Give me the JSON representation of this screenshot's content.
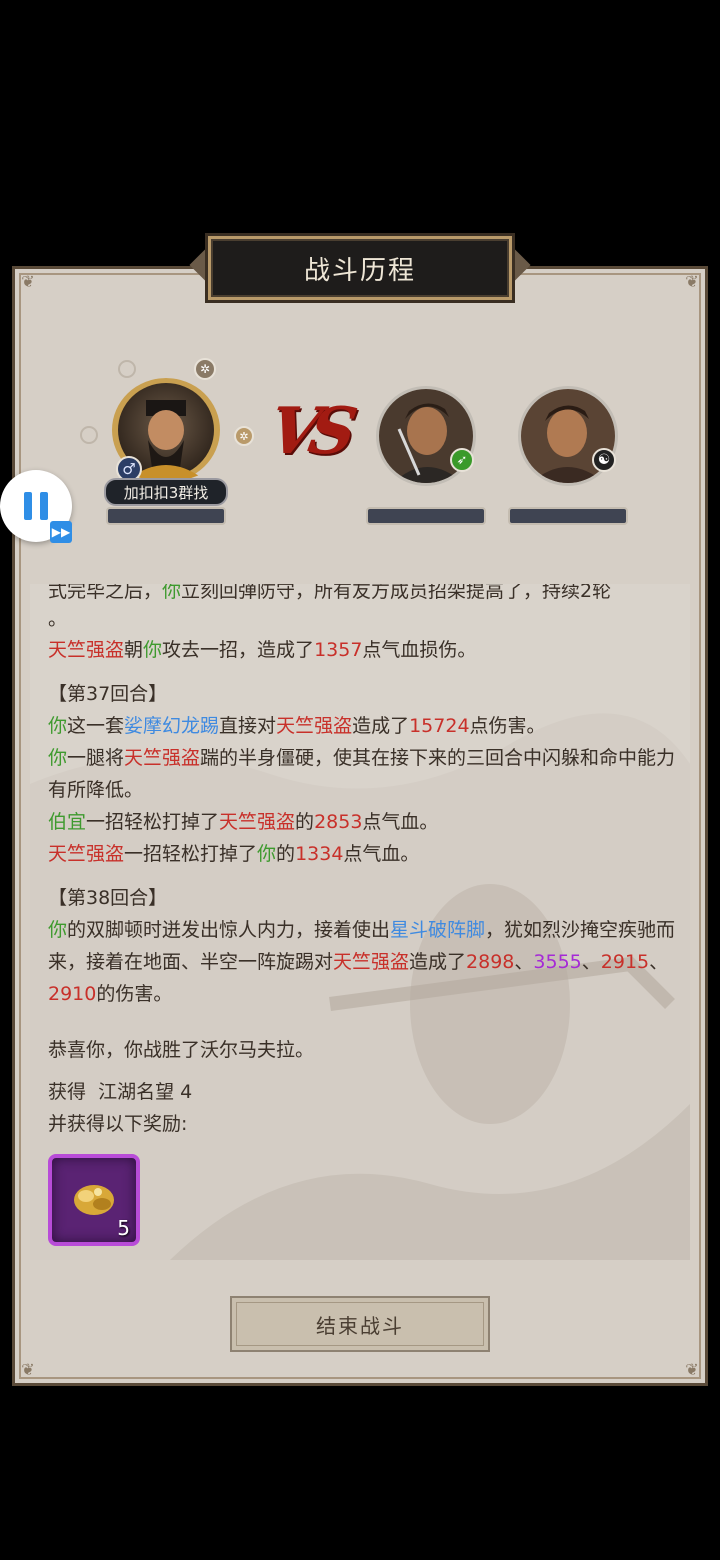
{
  "header": {
    "title": "战斗历程"
  },
  "player": {
    "name": "加扣扣3群找",
    "gender_icon": "male-icon",
    "badge_icon": "gear-icon"
  },
  "vs_label": "VS",
  "enemies": [
    {
      "badge_icon": "leaf-icon",
      "badge_color": "#3a9a2a"
    },
    {
      "badge_icon": "yin-yang-icon",
      "badge_color": "#222222"
    }
  ],
  "controls": {
    "pause_icon": "pause-icon",
    "fast_forward_icon": "fast-forward-icon"
  },
  "log": {
    "partial_top": [
      "式完毕之后，",
      "你",
      "立刻回弹防守，所有友方成员招架提高了，持续2轮"
    ],
    "partial_top2": "。",
    "l1": [
      "天竺强盗",
      "朝",
      "你",
      "攻去一招，造成了",
      "1357",
      "点气血损伤。"
    ],
    "round37": "【第37回合】",
    "l2": [
      "你",
      "这一套",
      "娑摩幻龙踢",
      "直接对",
      "天竺强盗",
      "造成了",
      "15724",
      "点伤害。"
    ],
    "l3": [
      "你",
      "一腿将",
      "天竺强盗",
      "踹的半身僵硬，使其在接下来的三回合中闪躲和命中能力有所降低。"
    ],
    "l4": [
      "伯宜",
      "一招轻松打掉了",
      "天竺强盗",
      "的",
      "2853",
      "点气血。"
    ],
    "l5": [
      "天竺强盗",
      "一招轻松打掉了",
      "你",
      "的",
      "1334",
      "点气血。"
    ],
    "round38": "【第38回合】",
    "l6": [
      "你",
      "的双脚顿时迸发出惊人内力，接着使出",
      "星斗破阵脚",
      "，犹如烈沙掩空疾驰而来，接着在地面、半空一阵旋踢对",
      "天竺强盗",
      "造成了",
      "2898",
      "、",
      "3555",
      "、",
      "2915",
      "、",
      "2910",
      "的伤害。"
    ],
    "victory": "恭喜你，你战胜了沃尔马夫拉。",
    "gain_label": "获得",
    "gain_value": "江湖名望 4",
    "reward_label": "并获得以下奖励:",
    "reward_item_icon": "gold-nugget-icon",
    "reward_count": "5"
  },
  "footer": {
    "end_button": "结束战斗"
  }
}
